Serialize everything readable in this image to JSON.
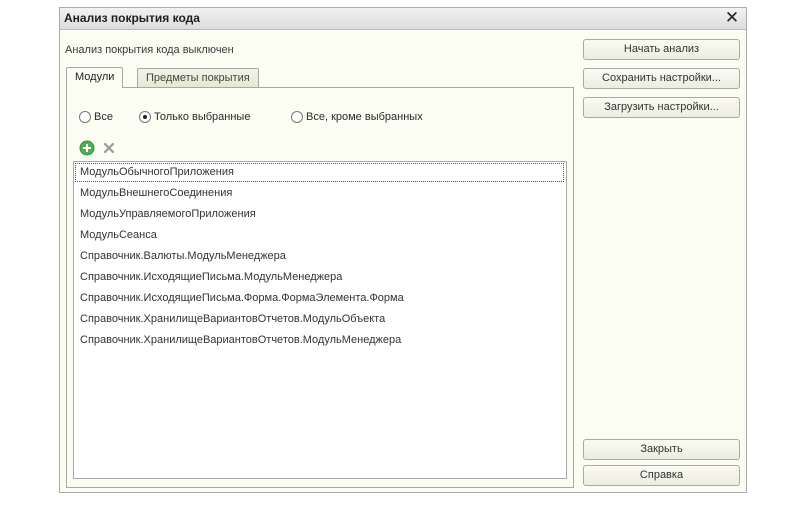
{
  "window": {
    "title": "Анализ покрытия кода",
    "close_glyph": "✕"
  },
  "status_text": "Анализ покрытия кода выключен",
  "tabs": [
    {
      "label": "Модули",
      "active": true
    },
    {
      "label": "Предметы покрытия",
      "active": false
    }
  ],
  "filter": {
    "options": [
      {
        "label": "Все",
        "checked": false
      },
      {
        "label": "Только выбранные",
        "checked": true
      },
      {
        "label": "Все, кроме выбранных",
        "checked": false
      }
    ]
  },
  "toolbar": {
    "add_icon": "add-icon",
    "delete_icon": "delete-icon"
  },
  "modules": [
    "МодульОбычногоПриложения",
    "МодульВнешнегоСоединения",
    "МодульУправляемогоПриложения",
    "МодульСеанса",
    "Справочник.Валюты.МодульМенеджера",
    "Справочник.ИсходящиеПисьма.МодульМенеджера",
    "Справочник.ИсходящиеПисьма.Форма.ФормаЭлемента.Форма",
    "Справочник.ХранилищеВариантовОтчетов.МодульОбъекта",
    "Справочник.ХранилищеВариантовОтчетов.МодульМенеджера"
  ],
  "selected_module_index": 0,
  "buttons": {
    "start": "Начать анализ",
    "save": "Сохранить настройки...",
    "load": "Загрузить настройки...",
    "close": "Закрыть",
    "help": "Справка"
  },
  "colors": {
    "add": "#4caf50",
    "delete": "#9a9a9a"
  }
}
